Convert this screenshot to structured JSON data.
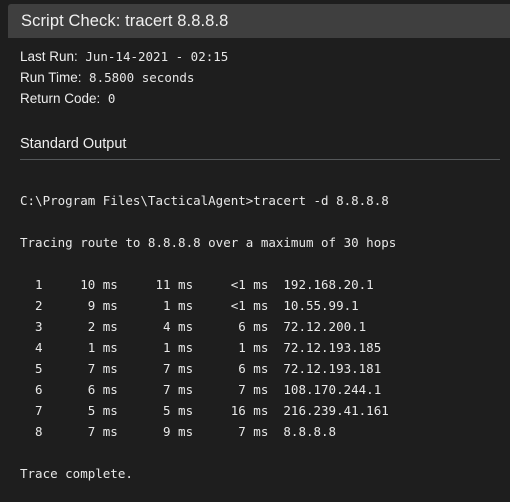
{
  "window": {
    "title": "Script Check: tracert 8.8.8.8"
  },
  "colors": {
    "background": "#1e1e1e",
    "titlebar": "#3f3f3f",
    "text": "#e8e8e8",
    "rule": "#55585a"
  },
  "meta": {
    "last_run_label": "Last Run:",
    "last_run_value": " Jun-14-2021 - 02:15",
    "run_time_label": "Run Time:",
    "run_time_value": " 8.5800 seconds",
    "return_code_label": "Return Code:",
    "return_code_value": " 0"
  },
  "section": {
    "standard_output_title": "Standard Output"
  },
  "console": {
    "lines": [
      "C:\\Program Files\\TacticalAgent>tracert -d 8.8.8.8",
      "",
      "Tracing route to 8.8.8.8 over a maximum of 30 hops",
      "",
      "  1     10 ms     11 ms     <1 ms  192.168.20.1",
      "  2      9 ms      1 ms     <1 ms  10.55.99.1",
      "  3      2 ms      4 ms      6 ms  72.12.200.1",
      "  4      1 ms      1 ms      1 ms  72.12.193.185",
      "  5      7 ms      7 ms      6 ms  72.12.193.181",
      "  6      6 ms      7 ms      7 ms  108.170.244.1",
      "  7      5 ms      5 ms     16 ms  216.239.41.161",
      "  8      7 ms      9 ms      7 ms  8.8.8.8",
      "",
      "Trace complete."
    ],
    "command": "C:\\Program Files\\TacticalAgent>tracert -d 8.8.8.8",
    "tracing_header": "Tracing route to 8.8.8.8 over a maximum of 30 hops",
    "trace_footer": "Trace complete.",
    "hops": [
      {
        "hop": "1",
        "rtt1": "10 ms",
        "rtt2": "11 ms",
        "rtt3": "<1 ms",
        "host": "192.168.20.1"
      },
      {
        "hop": "2",
        "rtt1": "9 ms",
        "rtt2": "1 ms",
        "rtt3": "<1 ms",
        "host": "10.55.99.1"
      },
      {
        "hop": "3",
        "rtt1": "2 ms",
        "rtt2": "4 ms",
        "rtt3": "6 ms",
        "host": "72.12.200.1"
      },
      {
        "hop": "4",
        "rtt1": "1 ms",
        "rtt2": "1 ms",
        "rtt3": "1 ms",
        "host": "72.12.193.185"
      },
      {
        "hop": "5",
        "rtt1": "7 ms",
        "rtt2": "7 ms",
        "rtt3": "6 ms",
        "host": "72.12.193.181"
      },
      {
        "hop": "6",
        "rtt1": "6 ms",
        "rtt2": "7 ms",
        "rtt3": "7 ms",
        "host": "108.170.244.1"
      },
      {
        "hop": "7",
        "rtt1": "5 ms",
        "rtt2": "5 ms",
        "rtt3": "16 ms",
        "host": "216.239.41.161"
      },
      {
        "hop": "8",
        "rtt1": "7 ms",
        "rtt2": "9 ms",
        "rtt3": "7 ms",
        "host": "8.8.8.8"
      }
    ]
  }
}
